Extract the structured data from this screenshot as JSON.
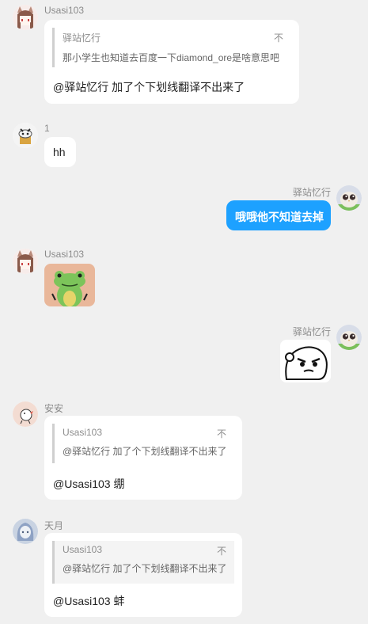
{
  "messages": [
    {
      "author": "Usasi103",
      "avatar": "anime-girl-avatar",
      "quote": {
        "author": "驿站忆行",
        "arrow": "不",
        "text": "那小学生也知道去百度一下diamond_ore是啥意思吧"
      },
      "text": "@驿站忆行 加了个下划线翻译不出来了"
    },
    {
      "author": "1",
      "avatar": "cartoon-character-avatar",
      "text": "hh"
    },
    {
      "author": "驿站忆行",
      "avatar": "owl-chick-avatar",
      "text": "哦哦他不知道去掉",
      "self": true
    },
    {
      "author": "Usasi103",
      "avatar": "anime-girl-avatar",
      "sticker": "frog-sticker"
    },
    {
      "author": "驿站忆行",
      "avatar": "owl-chick-avatar",
      "sticker": "ghost-face-sticker",
      "self": true
    },
    {
      "author": "安安",
      "avatar": "sketch-bird-avatar",
      "quote": {
        "author": "Usasi103",
        "arrow": "不",
        "text": "@驿站忆行 加了个下划线翻译不出来了"
      },
      "text": "@Usasi103 绷"
    },
    {
      "author": "天月",
      "avatar": "blue-hair-girl-avatar",
      "quote": {
        "author": "Usasi103",
        "arrow": "不",
        "text": "@驿站忆行 加了个下划线翻译不出来了"
      },
      "text": "@Usasi103 蚌"
    }
  ],
  "colors": {
    "background": "#f0f0f0",
    "bubble": "#ffffff",
    "self_bubble": "#1da1ff",
    "name": "#8a8a8a"
  }
}
